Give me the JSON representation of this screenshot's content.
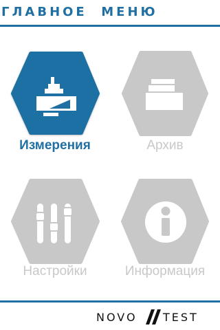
{
  "header": {
    "title": "ГЛАВНОЕ  МЕНЮ"
  },
  "menu": {
    "items": [
      {
        "label": "Измерения",
        "icon": "measurement-icon",
        "state": "active"
      },
      {
        "label": "Архив",
        "icon": "archive-folder-icon",
        "state": "inactive"
      },
      {
        "label": "Настройки",
        "icon": "settings-sliders-icon",
        "state": "inactive"
      },
      {
        "label": "Информация",
        "icon": "info-icon",
        "state": "inactive"
      }
    ]
  },
  "footer": {
    "logo_left": "NOVO",
    "logo_right": "TEST"
  },
  "colors": {
    "accent": "#1f6fa3",
    "inactive": "#c8c8c8",
    "logo_text": "#111111"
  }
}
